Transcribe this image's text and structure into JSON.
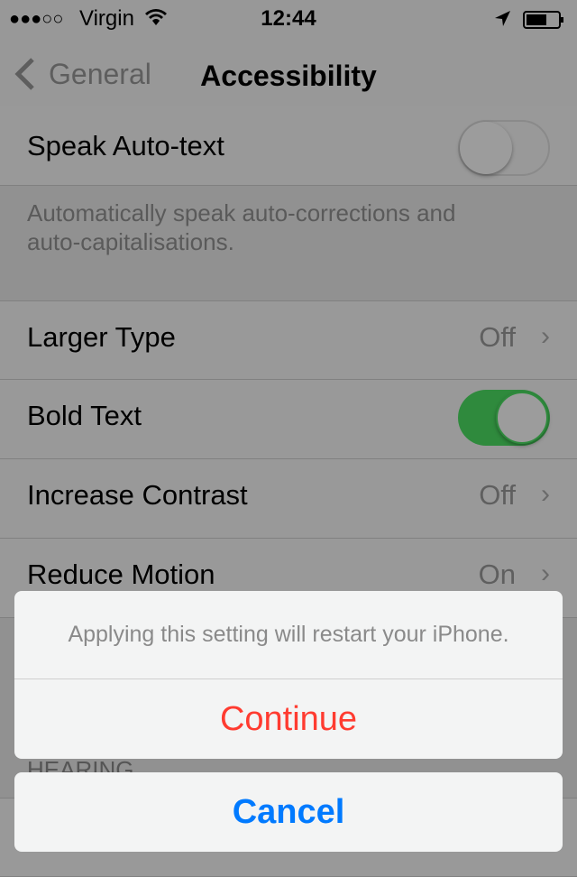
{
  "status": {
    "signal": "●●●○○",
    "carrier": "Virgin",
    "time": "12:44",
    "wifi_icon": "wifi-icon",
    "location_icon": "location-arrow-icon",
    "battery_icon": "battery-icon"
  },
  "nav": {
    "back_label": "General",
    "title": "Accessibility"
  },
  "rows": {
    "speak_auto_text": {
      "label": "Speak Auto-text",
      "on": false
    },
    "footer": "Automatically speak auto-corrections and auto-capitalisations.",
    "larger_type": {
      "label": "Larger Type",
      "value": "Off"
    },
    "bold_text": {
      "label": "Bold Text",
      "on": true
    },
    "increase_contrast": {
      "label": "Increase Contrast",
      "value": "Off"
    },
    "reduce_motion": {
      "label": "Reduce Motion",
      "value": "On"
    },
    "hearing_header": "HEARING"
  },
  "sheet": {
    "message": "Applying this setting will restart your iPhone.",
    "continue": "Continue",
    "cancel": "Cancel",
    "continue_color": "#ff3b30",
    "cancel_color": "#007aff"
  },
  "colors": {
    "toggle_on": "#2f8a3d"
  }
}
